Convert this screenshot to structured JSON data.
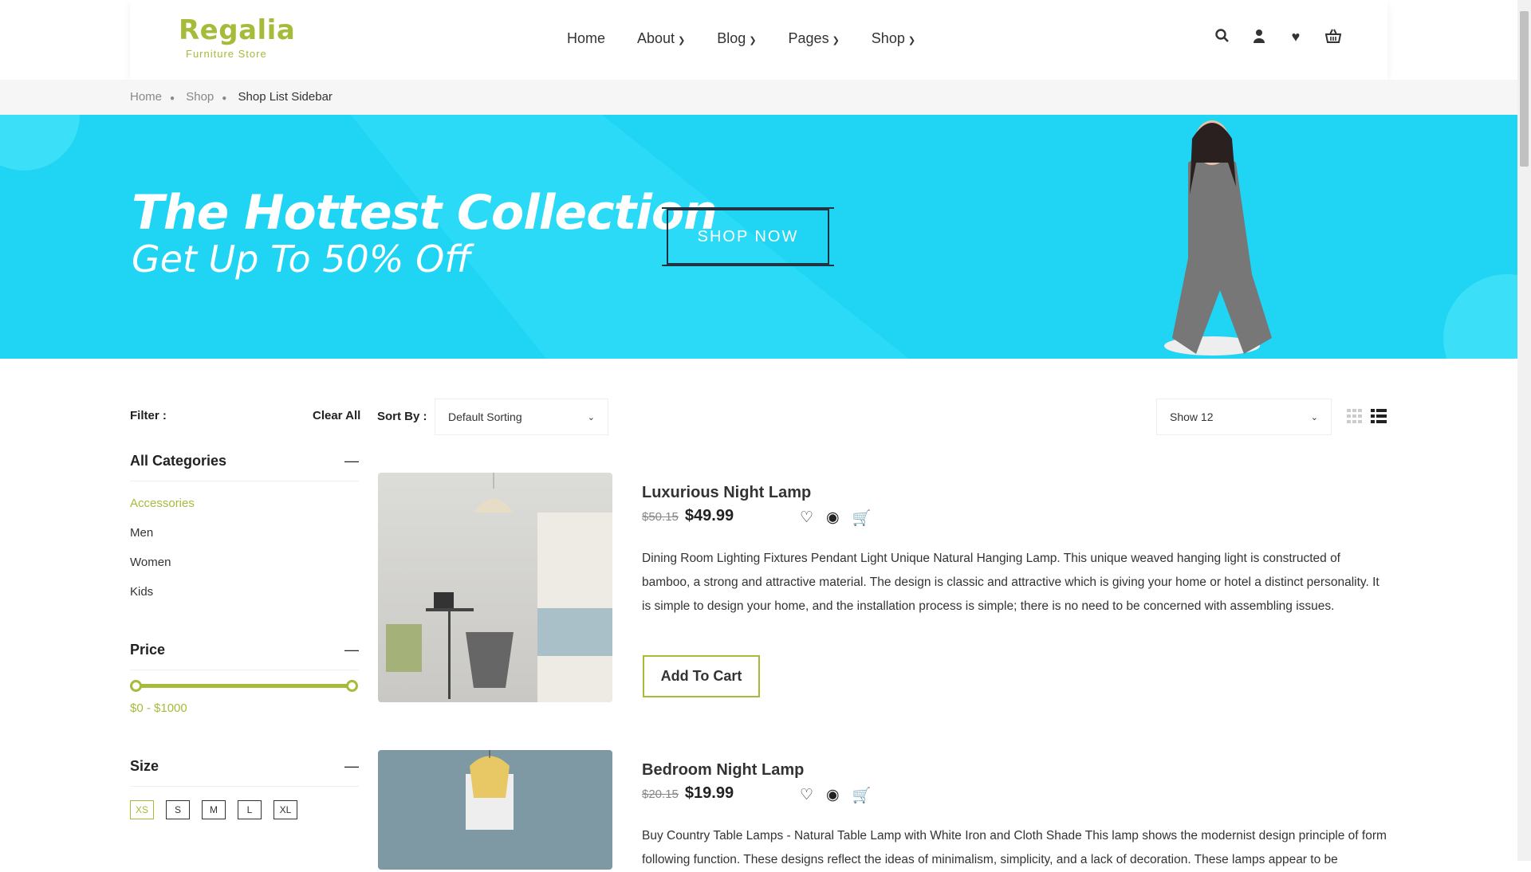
{
  "logo": {
    "title": "Regalia",
    "subtitle": "Furniture Store"
  },
  "nav": [
    {
      "label": "Home"
    },
    {
      "label": "About"
    },
    {
      "label": "Blog"
    },
    {
      "label": "Pages"
    },
    {
      "label": "Shop"
    }
  ],
  "header_icons": [
    "search-icon",
    "user-icon",
    "heart-icon",
    "basket-icon"
  ],
  "breadcrumb": [
    "Home",
    "Shop",
    "Shop List Sidebar"
  ],
  "banner": {
    "title": "The Hottest Collection",
    "subtitle": "Get Up To 50% Off",
    "button": "SHOP NOW"
  },
  "filter": {
    "label": "Filter :",
    "clear": "Clear All"
  },
  "sort": {
    "label": "Sort By :",
    "value": "Default Sorting"
  },
  "show": {
    "value": "Show 12"
  },
  "sidebar": {
    "categories": {
      "title": "All Categories",
      "items": [
        "Accessories",
        "Men",
        "Women",
        "Kids"
      ]
    },
    "price": {
      "title": "Price",
      "range": "$0 - $1000",
      "min": 0,
      "max": 1000
    },
    "size": {
      "title": "Size",
      "items": [
        "XS",
        "S",
        "M",
        "L",
        "XL"
      ]
    }
  },
  "products": [
    {
      "title": "Luxurious Night Lamp",
      "old_price": "$50.15",
      "price": "$49.99",
      "description": "Dining Room Lighting Fixtures Pendant Light Unique Natural Hanging Lamp. This unique weaved hanging light is constructed of bamboo, a strong and attractive material. The design is classic and attractive which is giving your home or hotel a distinct personality. It is simple to design your home, and the installation process is simple; there is no need to be concerned with assembling issues.",
      "button": "Add To Cart"
    },
    {
      "title": "Bedroom Night Lamp",
      "old_price": "$20.15",
      "price": "$19.99",
      "description": "Buy Country Table Lamps - Natural Table Lamp with White Iron and Cloth Shade This lamp shows the modernist design principle of form following function. These designs reflect the ideas of minimalism, simplicity, and a lack of decoration. These lamps appear to be"
    }
  ],
  "colors": {
    "accent": "#a5bb3a",
    "banner": "#1fd5f3"
  }
}
